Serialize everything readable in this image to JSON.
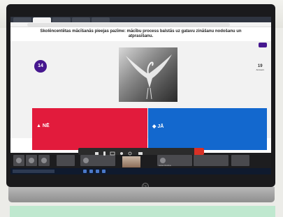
{
  "kahoot": {
    "question": "Skolēncentētas mācīšanās pieejas pazīme: mācību process balstās uz gatavu zināšanu nodošanu un atprasīšanu.",
    "timer": "14",
    "answers_count": "19",
    "answers_label": "Answers",
    "option_red": "NĒ",
    "option_blue": "JĀ",
    "option_red_color": "#e21b3c",
    "option_blue_color": "#1368ce"
  },
  "meet": {
    "self_label": "Iveta Ozolina"
  },
  "laptop": {
    "logo": "hp"
  }
}
